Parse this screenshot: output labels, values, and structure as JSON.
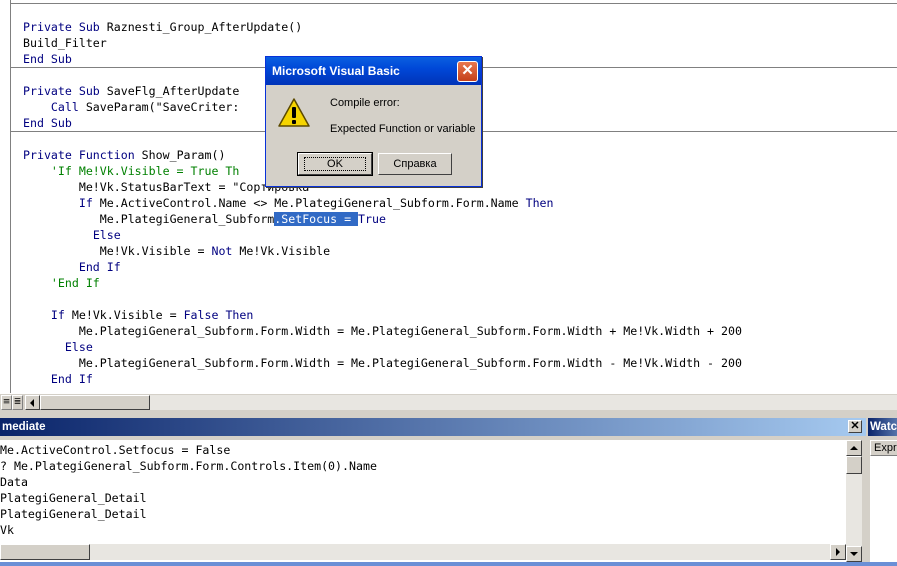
{
  "editor": {
    "lines": [
      [
        {
          "t": "Private Sub ",
          "c": "kw"
        },
        {
          "t": "Raznesti_Group_AfterUpdate()"
        }
      ],
      [
        {
          "t": "Build_Filter"
        }
      ],
      [
        {
          "t": "End Sub",
          "c": "kw"
        }
      ],
      [
        {
          "t": ""
        }
      ],
      [
        {
          "t": "Private Sub ",
          "c": "kw"
        },
        {
          "t": "SaveFlg_AfterUpdate"
        }
      ],
      [
        {
          "t": "    "
        },
        {
          "t": "Call ",
          "c": "kw"
        },
        {
          "t": "SaveParam(\"SaveCriter:"
        }
      ],
      [
        {
          "t": "End Sub",
          "c": "kw"
        }
      ],
      [
        {
          "t": ""
        }
      ],
      [
        {
          "t": "Private Function ",
          "c": "kw"
        },
        {
          "t": "Show_Param()"
        }
      ],
      [
        {
          "t": "    'If Me!Vk.Visible = True Th",
          "c": "cm"
        }
      ],
      [
        {
          "t": "        Me!Vk.StatusBarText = \"Сортировка\""
        }
      ],
      [
        {
          "t": "        "
        },
        {
          "t": "If ",
          "c": "kw"
        },
        {
          "t": "Me.ActiveControl.Name <> Me.PlategiGeneral_Subform.Form.Name "
        },
        {
          "t": "Then",
          "c": "kw"
        }
      ],
      [
        {
          "t": "           Me.PlategiGeneral_Subform"
        },
        {
          "t": ".SetFocus = ",
          "c": "sel"
        },
        {
          "t": "True",
          "c": "kw"
        }
      ],
      [
        {
          "t": "          "
        },
        {
          "t": "Else",
          "c": "kw"
        }
      ],
      [
        {
          "t": "           Me!Vk.Visible = "
        },
        {
          "t": "Not ",
          "c": "kw"
        },
        {
          "t": "Me!Vk.Visible"
        }
      ],
      [
        {
          "t": "        "
        },
        {
          "t": "End If",
          "c": "kw"
        }
      ],
      [
        {
          "t": "    'End If",
          "c": "cm"
        }
      ],
      [
        {
          "t": ""
        }
      ],
      [
        {
          "t": "    "
        },
        {
          "t": "If ",
          "c": "kw"
        },
        {
          "t": "Me!Vk.Visible = "
        },
        {
          "t": "False Then",
          "c": "kw"
        }
      ],
      [
        {
          "t": "        Me.PlategiGeneral_Subform.Form.Width = Me.PlategiGeneral_Subform.Form.Width + Me!Vk.Width + 200"
        }
      ],
      [
        {
          "t": "      "
        },
        {
          "t": "Else",
          "c": "kw"
        }
      ],
      [
        {
          "t": "        Me.PlategiGeneral_Subform.Form.Width = Me.PlategiGeneral_Subform.Form.Width - Me!Vk.Width - 200"
        }
      ],
      [
        {
          "t": "    "
        },
        {
          "t": "End If",
          "c": "kw"
        }
      ]
    ],
    "view_buttons": [
      "≡",
      "≣"
    ]
  },
  "immediate": {
    "title": "mediate",
    "close_label": "✕",
    "lines": [
      "Me.ActiveControl.Setfocus = False",
      "? Me.PlategiGeneral_Subform.Form.Controls.Item(0).Name",
      "Data",
      "PlategiGeneral_Detail",
      "PlategiGeneral_Detail",
      "Vk"
    ]
  },
  "watches": {
    "title": "Watc",
    "column_header": "Expr"
  },
  "dialog": {
    "title": "Microsoft Visual Basic",
    "close_label": "✕",
    "message_title": "Compile error:",
    "message": "Expected Function or variable",
    "ok_label": "OK",
    "help_label": "Справка",
    "icon": "warning-icon"
  },
  "colors": {
    "keyword": "#000080",
    "comment": "#008000",
    "selection": "#316ac5",
    "title_bar": "#0a246a",
    "dialog_title": "#0048d8"
  }
}
